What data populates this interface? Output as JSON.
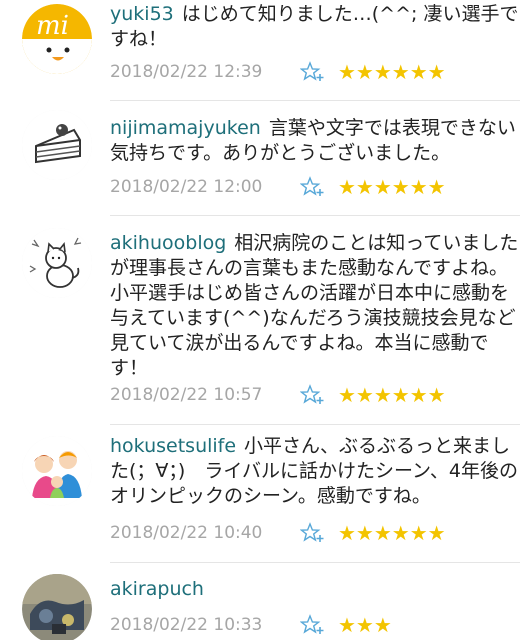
{
  "colors": {
    "username": "#1e6f7a",
    "star": "#f3c400",
    "star_add": "#58a8d8",
    "date": "#a6a6a6",
    "divider": "#e5e5e5"
  },
  "comments": [
    {
      "avatar": "mi-duck-avatar",
      "username": "yuki53",
      "text": "はじめて知りました…(^^; 凄い選手ですね！",
      "date": "2018/02/22 12:39",
      "stars_text": "★★★★★★",
      "star_count": 6,
      "star_add_icon": "add-star-icon"
    },
    {
      "avatar": "cake-avatar",
      "username": "nijimamajyuken",
      "text": "言葉や文字では表現できない気持ちです。ありがとうございました。",
      "date": "2018/02/22 12:00",
      "stars_text": "★★★★★★",
      "star_count": 6,
      "star_add_icon": "add-star-icon"
    },
    {
      "avatar": "cat-avatar",
      "username": "akihuooblog",
      "text": "相沢病院のことは知っていましたが理事長さんの言葉もまた感動なんですよね。小平選手はじめ皆さんの活躍が日本中に感動を与えています(^^)なんだろう演技競技会見など見ていて涙が出るんですよね。本当に感動です！",
      "date": "2018/02/22 10:57",
      "stars_text": "★★★★★★",
      "star_count": 6,
      "star_add_icon": "add-star-icon"
    },
    {
      "avatar": "family-avatar",
      "username": "hokusetsulife",
      "text": "小平さん、ぶるぶるっと来ました(；∀；)　ライバルに話かけたシーン、4年後のオリンピックのシーン。感動ですね。",
      "date": "2018/02/22 10:40",
      "stars_text": "★★★★★★",
      "star_count": 6,
      "star_add_icon": "add-star-icon"
    },
    {
      "avatar": "photo-avatar",
      "username": "akirapuch",
      "text": "",
      "date": "2018/02/22 10:33",
      "stars_text": "★★★",
      "star_count": 3,
      "star_add_icon": "add-star-icon"
    }
  ]
}
